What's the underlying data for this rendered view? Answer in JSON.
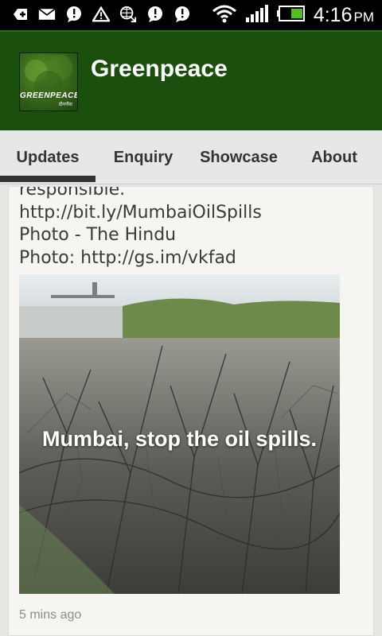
{
  "status_bar": {
    "icons": [
      "add-icon",
      "mail-icon",
      "chat-alert-icon",
      "warning-icon",
      "web-sync-icon",
      "chat-alert-icon",
      "chat-alert-icon"
    ],
    "right_icons": [
      "wifi-icon",
      "signal-icon",
      "battery-icon"
    ],
    "time": "4:16",
    "ampm": "PM"
  },
  "app_bar": {
    "title": "Greenpeace",
    "logo_text": "GREENPEACE",
    "logo_subtext": "ग्रीनपीस",
    "color": "#1b4f0e"
  },
  "tabs": [
    {
      "label": "Updates",
      "selected": true
    },
    {
      "label": "Enquiry",
      "selected": false
    },
    {
      "label": "Showcase",
      "selected": false
    },
    {
      "label": "About",
      "selected": false
    }
  ],
  "post": {
    "cut_line": "responsible.",
    "line_link": "http://bit.ly/MumbaiOilSpills",
    "line_credit": "Photo - The Hindu",
    "line_photo": "Photo: http://gs.im/vkfad",
    "image_caption": "Mumbai, stop the oil spills.",
    "timestamp": "5 mins ago"
  }
}
